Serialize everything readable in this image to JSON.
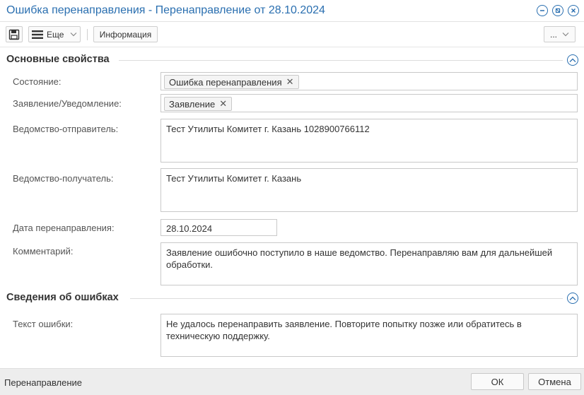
{
  "window": {
    "title": "Ошибка перенаправления - Перенаправление от 28.10.2024"
  },
  "toolbar": {
    "more_label": "Еще",
    "info_label": "Информация",
    "dots_label": "..."
  },
  "sections": {
    "main": {
      "title": "Основные свойства",
      "status": {
        "label": "Состояние:",
        "chip": "Ошибка перенаправления"
      },
      "app_type": {
        "label": "Заявление/Уведомление:",
        "chip": "Заявление"
      },
      "sender": {
        "label": "Ведомство-отправитель:",
        "value": "Тест Утилиты Комитет г. Казань 1028900766112"
      },
      "receiver": {
        "label": "Ведомство-получатель:",
        "value": "Тест Утилиты Комитет г. Казань"
      },
      "date": {
        "label": "Дата перенаправления:",
        "value": "28.10.2024"
      },
      "comment": {
        "label": "Комментарий:",
        "value": "Заявление ошибочно поступило в наше ведомство. Перенаправляю вам для дальнейшей обработки."
      }
    },
    "errors": {
      "title": "Сведения об ошибках",
      "error_text": {
        "label": "Текст ошибки:",
        "value": "Не удалось перенаправить заявление. Повторите попытку позже или обратитесь в техническую поддержку."
      }
    }
  },
  "footer": {
    "text": "Перенаправление",
    "ok_label": "ОК",
    "cancel_label": "Отмена"
  },
  "colors": {
    "accent": "#2a6fb0",
    "footer_bg": "#ededed"
  }
}
